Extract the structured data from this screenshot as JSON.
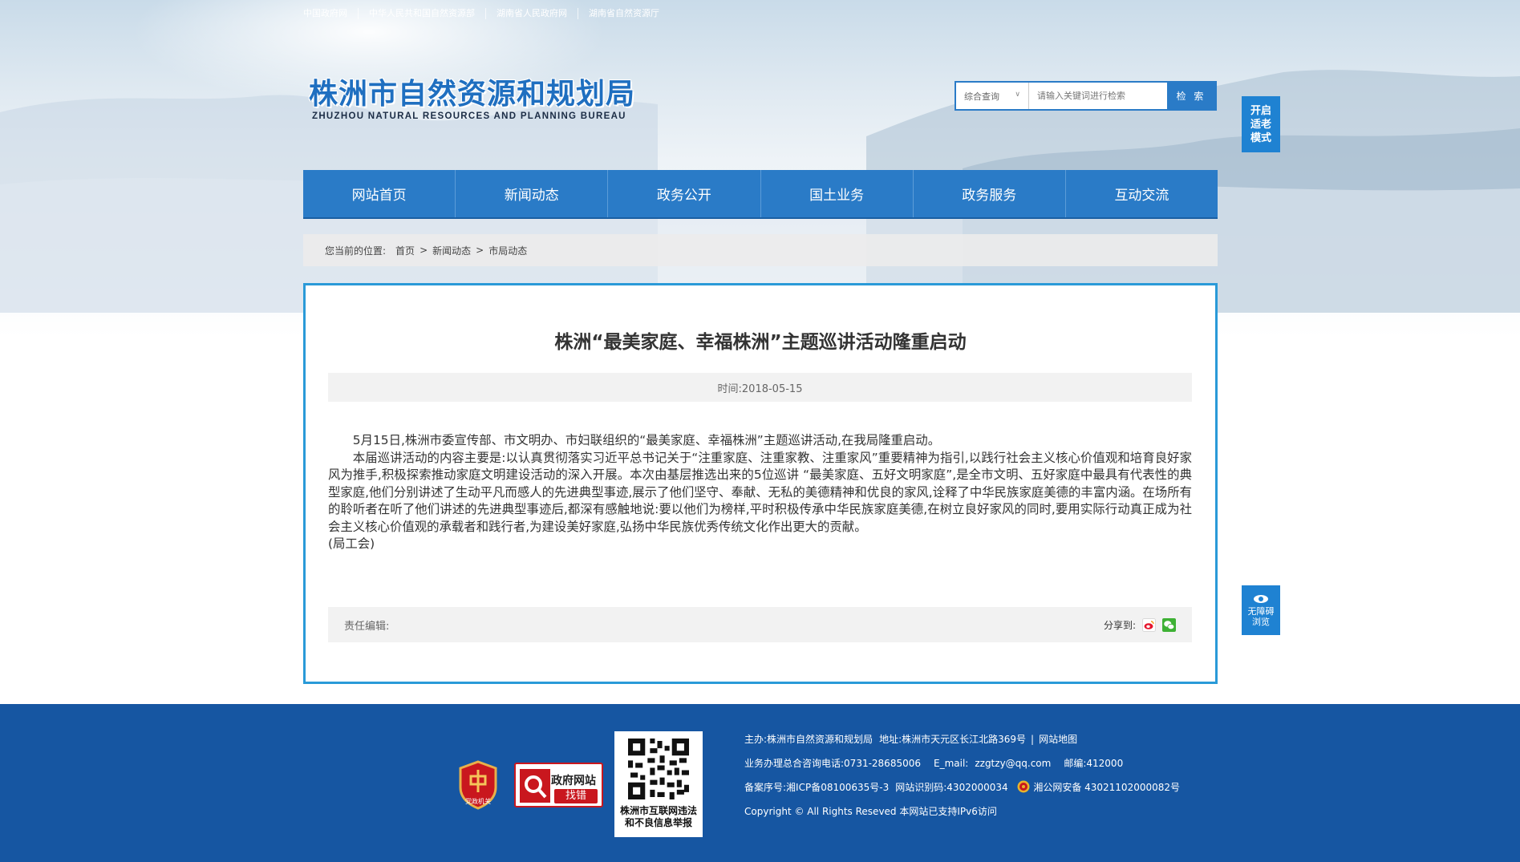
{
  "top_links": [
    "中国政府网",
    "中华人民共和国自然资源部",
    "湖南省人民政府网",
    "湖南省自然资源厅"
  ],
  "logo": {
    "cn": "株洲市自然资源和规划局",
    "en": "ZHUZHOU NATURAL RESOURCES AND PLANNING BUREAU"
  },
  "search": {
    "scope": "综合查询",
    "placeholder": "请输入关键词进行检索",
    "button": "检 索"
  },
  "elder_mode": [
    "开启",
    "适老",
    "模式"
  ],
  "accessibility": [
    "无障碍",
    "浏览"
  ],
  "nav": [
    "网站首页",
    "新闻动态",
    "政务公开",
    "国土业务",
    "政务服务",
    "互动交流"
  ],
  "breadcrumb": {
    "label": "您当前的位置:",
    "items": [
      "首页",
      "新闻动态",
      "市局动态"
    ],
    "sep": ">"
  },
  "article": {
    "title": "株洲“最美家庭、幸福株洲”主题巡讲活动隆重启动",
    "time": "时间:2018-05-15",
    "paragraphs": [
      "5月15日,株洲市委宣传部、市文明办、市妇联组织的“最美家庭、幸福株洲”主题巡讲活动,在我局隆重启动。",
      "本届巡讲活动的内容主要是:以认真贯彻落实习近平总书记关于“注重家庭、注重家教、注重家风”重要精神为指引,以践行社会主义核心价值观和培育良好家风为推手,积极探索推动家庭文明建设活动的深入开展。本次由基层推选出来的5位巡讲 “最美家庭、五好文明家庭”,是全市文明、五好家庭中最具有代表性的典型家庭,他们分别讲述了生动平凡而感人的先进典型事迹,展示了他们坚守、奉献、无私的美德精神和优良的家风,诠释了中华民族家庭美德的丰富内涵。在场所有的聆听者在听了他们讲述的先进典型事迹后,都深有感触地说:要以他们为榜样,平时积极传承中华民族家庭美德,在树立良好家风的同时,要用实际行动真正成为社会主义核心价值观的承载者和践行者,为建设美好家庭,弘扬中华民族优秀传统文化作出更大的贡献。",
      "(局工会)"
    ],
    "editor_label": "责任编辑:",
    "share_label": "分享到:"
  },
  "footer": {
    "badge_party": "党政机关",
    "badge_error": {
      "line1": "政府网站",
      "line2": "找错"
    },
    "qr_caption": [
      "株洲市互联网违法",
      "和不良信息举报"
    ],
    "host_label": "主办:",
    "host": "株洲市自然资源和规划局",
    "address_label": "地址:",
    "address": "株洲市天元区长江北路369号",
    "sitemap": "网站地图",
    "phone_label": "业务办理总合咨询电话:",
    "phone": "0731-28685006",
    "email_label": "E_mail:",
    "email": "zzgtzy@qq.com",
    "zip_label": "邮编:",
    "zip": "412000",
    "icp_label": "备案序号:",
    "icp": "湘ICP备08100635号-3",
    "site_id_label": "网站识别码:",
    "site_id": "4302000034",
    "police": "湘公网安备 43021102000082号",
    "copyright": "Copyright © All Rights Reseved 本网站已支持IPv6访问"
  },
  "colors": {
    "nav_blue": "#2a7bc7",
    "panel_border": "#2a9ad8",
    "footer_blue": "#1656a2",
    "badge_red": "#c9171e"
  }
}
